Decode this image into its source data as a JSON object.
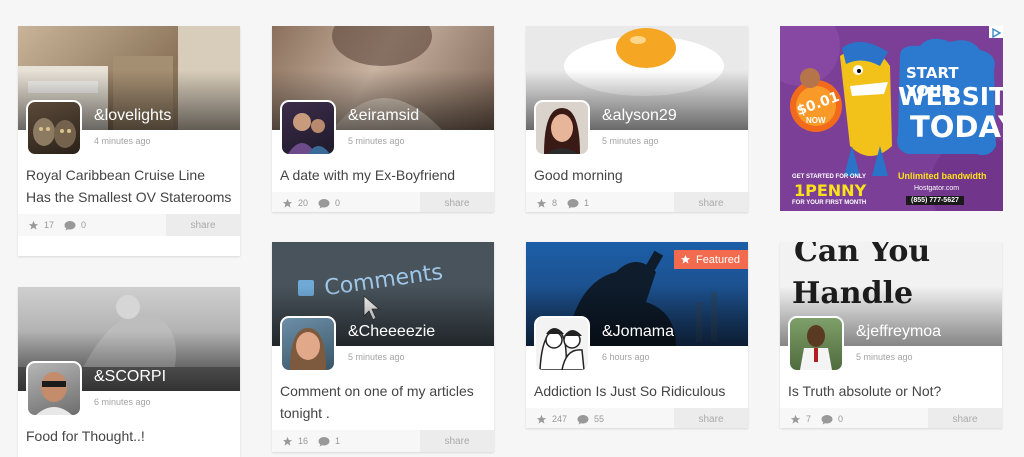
{
  "share_label": "share",
  "featured_label": "Featured",
  "cards": [
    {
      "username": "&lovelights",
      "time": "4 minutes ago",
      "title": "Royal Caribbean Cruise Line Has the Smallest OV Staterooms",
      "likes": "17",
      "comments": "0"
    },
    {
      "username": "&eiramsid",
      "time": "5 minutes ago",
      "title": "A date with my Ex-Boyfriend",
      "likes": "20",
      "comments": "0"
    },
    {
      "username": "&alyson29",
      "time": "5 minutes ago",
      "title": "Good morning",
      "likes": "8",
      "comments": "1"
    },
    {
      "username": "&SCORPI",
      "time": "6 minutes ago",
      "title": "Food for Thought..!"
    },
    {
      "username": "&Cheeeezie",
      "time": "5 minutes ago",
      "title": "Comment on one of my articles tonight .",
      "likes": "16",
      "comments": "1"
    },
    {
      "username": "&Jomama",
      "time": "6 hours ago",
      "title": "Addiction Is Just So Ridiculous",
      "likes": "247",
      "comments": "55"
    },
    {
      "username": "&jeffreymoa",
      "time": "5 minutes ago",
      "title": "Is Truth absolute or Not?",
      "likes": "7",
      "comments": "0"
    }
  ],
  "hero_text": {
    "comments_word": "Comments",
    "can_you_handle": [
      "Can You",
      "Handle"
    ]
  },
  "ad": {
    "line1": "START YOUR",
    "line2": "WEBSITE",
    "line3": "TODAY",
    "price": "$0.01",
    "price_sub": "NOW",
    "started": "GET STARTED FOR ONLY",
    "penny": "1PENNY",
    "first_month": "FOR YOUR FIRST MONTH",
    "unlimited": "Unlimited bandwidth",
    "domain": "Hostgator.com",
    "phone": "(855) 777-5627",
    "choices_icon": "adchoices-icon"
  }
}
